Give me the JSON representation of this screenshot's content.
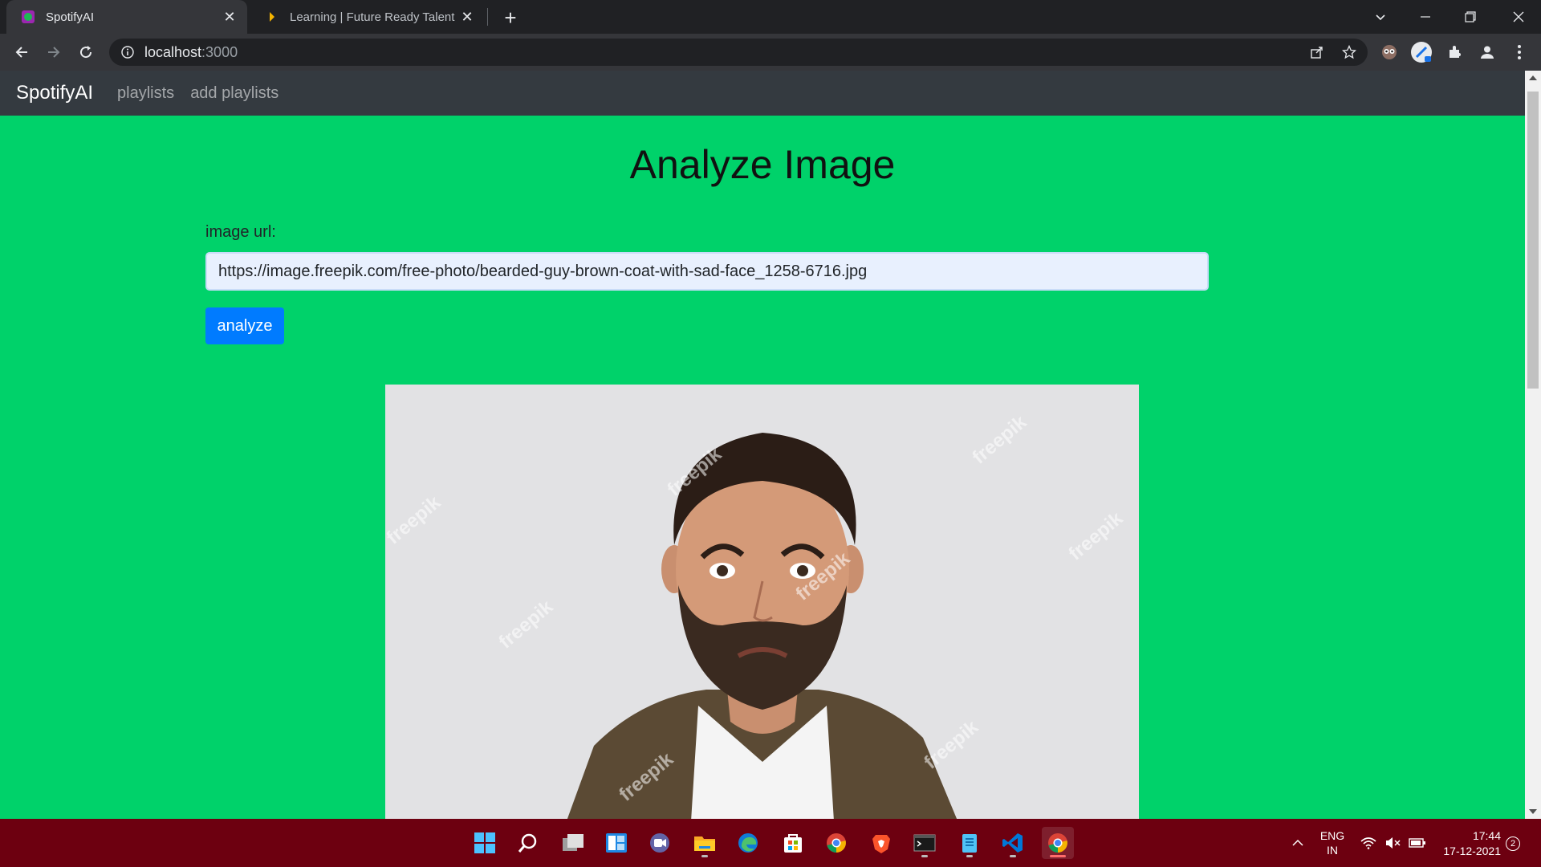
{
  "browser": {
    "tabs": [
      {
        "title": "SpotifyAI",
        "active": true,
        "favicon": "spotifyai-favicon"
      },
      {
        "title": "Learning | Future Ready Talent",
        "active": false,
        "favicon": "future-ready-favicon"
      }
    ],
    "url_host": "localhost",
    "url_port": ":3000"
  },
  "app": {
    "brand": "SpotifyAI",
    "nav": [
      "playlists",
      "add playlists"
    ],
    "page_title": "Analyze Image",
    "field_label": "image url:",
    "input_value": "https://image.freepik.com/free-photo/bearded-guy-brown-coat-with-sad-face_1258-6716.jpg",
    "button_label": "analyze",
    "image_alt": "bearded guy brown coat with sad face",
    "watermark": "freepik"
  },
  "taskbar": {
    "apps": [
      "windows-start-icon",
      "search-icon",
      "task-view-icon",
      "widgets-icon",
      "teams-chat-icon",
      "file-explorer-icon",
      "edge-icon",
      "store-icon",
      "chrome-icon",
      "brave-icon",
      "terminal-icon",
      "notepad-icon",
      "vscode-icon",
      "chrome-icon"
    ],
    "lang_line1": "ENG",
    "lang_line2": "IN",
    "time": "17:44",
    "date": "17-12-2021",
    "notifications": "2"
  },
  "colors": {
    "page_bg": "#00d26a",
    "navbar_bg": "#343a40",
    "button_bg": "#007bff",
    "taskbar_bg": "#6d0010"
  }
}
